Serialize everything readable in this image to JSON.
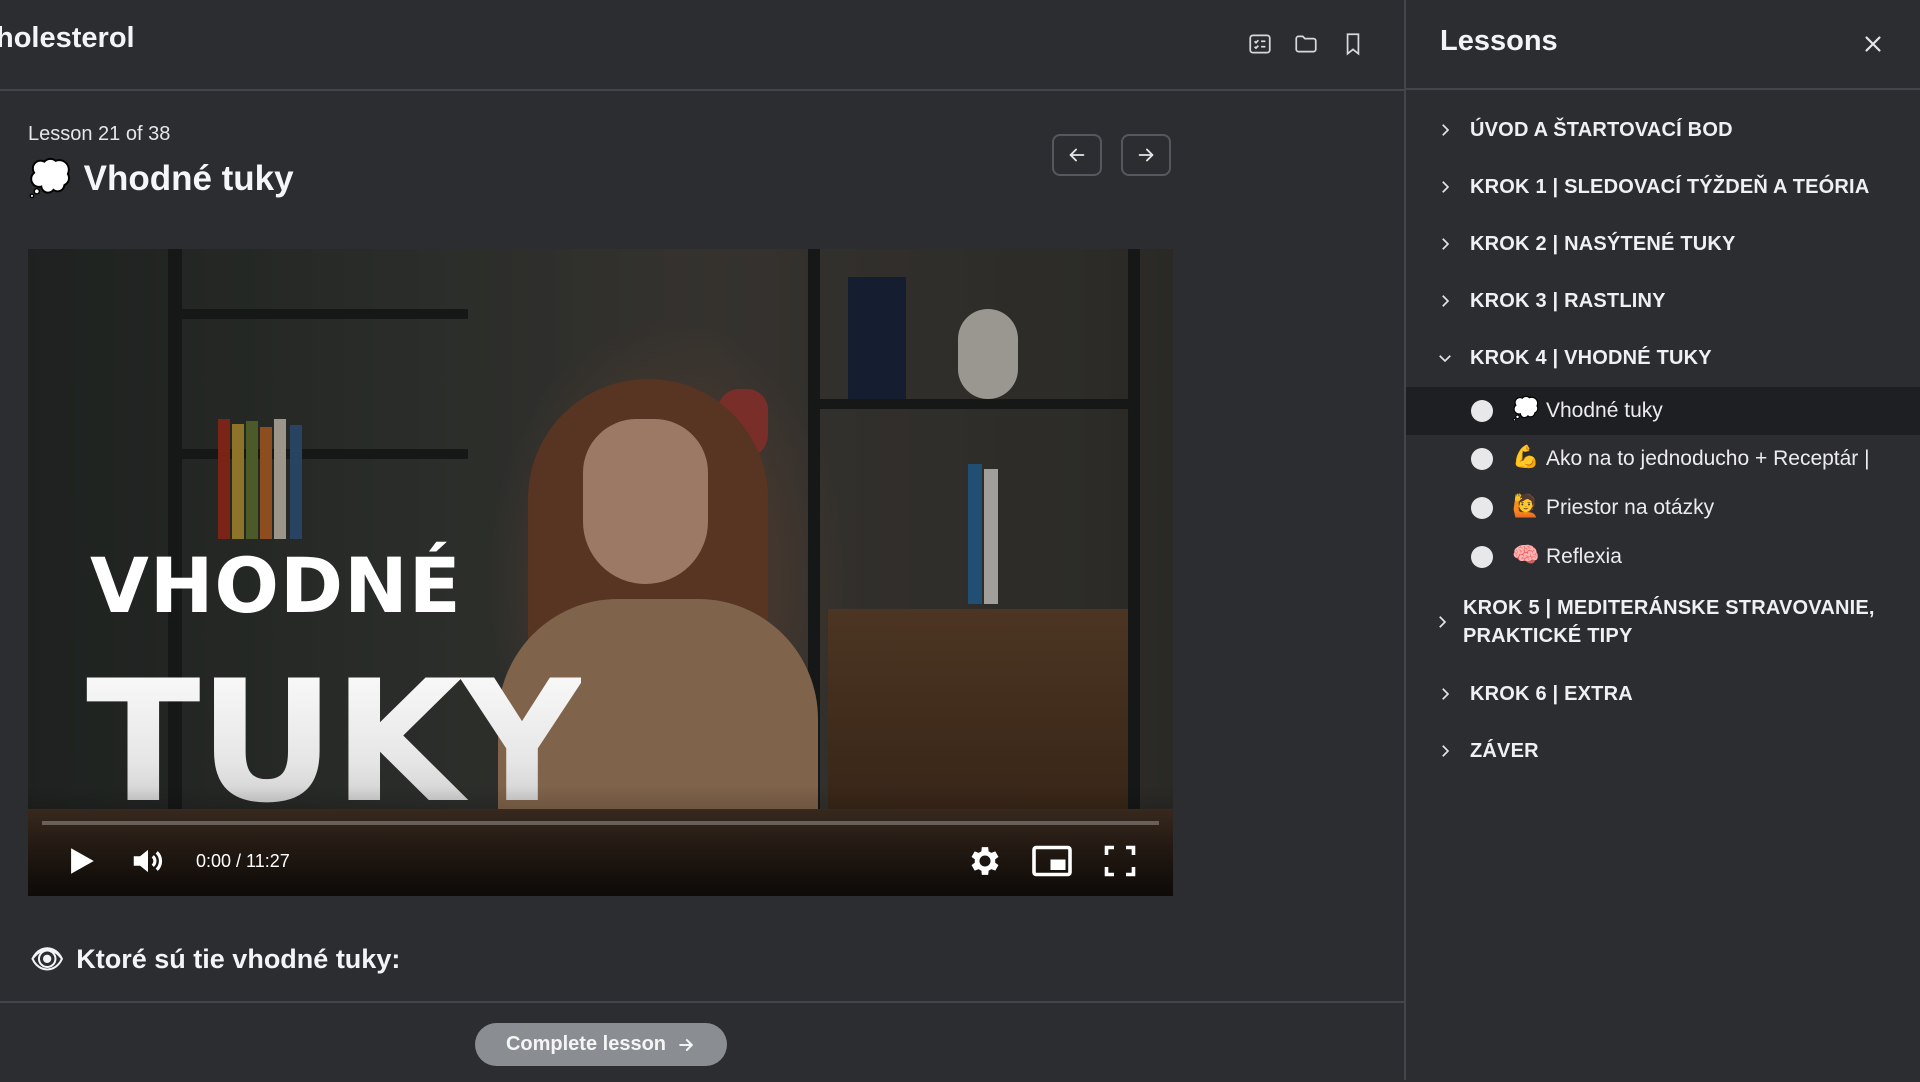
{
  "header": {
    "course_title": "holesterol",
    "icons": [
      "list-check-icon",
      "folder-icon",
      "bookmark-icon"
    ]
  },
  "lesson": {
    "counter": "Lesson 21 of 38",
    "emoji": "💭",
    "title": "Vhodné tuky"
  },
  "video": {
    "overlay_line1": "VHODNÉ",
    "overlay_line2": "TUKY",
    "time": "0:00 / 11:27",
    "progress": 0
  },
  "content": {
    "heading_emoji": "👁",
    "heading": "Ktoré sú tie vhodné tuky:"
  },
  "footer": {
    "complete_label": "Complete lesson"
  },
  "sidebar": {
    "title": "Lessons",
    "sections": [
      {
        "label": "ÚVOD A ŠTARTOVACÍ BOD",
        "expanded": false
      },
      {
        "label": "KROK 1 | SLEDOVACÍ TÝŽDEŇ A TEÓRIA",
        "expanded": false
      },
      {
        "label": "KROK 2 | NASÝTENÉ TUKY",
        "expanded": false
      },
      {
        "label": "KROK 3 | RASTLINY",
        "expanded": false
      },
      {
        "label": "KROK 4 | VHODNÉ TUKY",
        "expanded": true
      },
      {
        "label_line1": "KROK 5 | MEDITERÁNSKE STRAVOVANIE,",
        "label_line2": "PRAKTICKÉ TIPY",
        "expanded": false
      },
      {
        "label": "KROK 6 | EXTRA",
        "expanded": false
      },
      {
        "label": "ZÁVER",
        "expanded": false
      }
    ],
    "lessons": [
      {
        "emoji": "💭",
        "title": "Vhodné tuky",
        "active": true
      },
      {
        "emoji": "💪",
        "title": "Ako na to jednoducho + Receptár |",
        "active": false
      },
      {
        "emoji": "🙋",
        "title": "Priestor na otázky",
        "active": false
      },
      {
        "emoji": "🧠",
        "title": "Reflexia",
        "active": false
      }
    ]
  },
  "colors": {
    "background": "#2b2d31",
    "divider": "#42454b",
    "active_row": "#1e1f22",
    "complete_button": "#8a8d92"
  }
}
